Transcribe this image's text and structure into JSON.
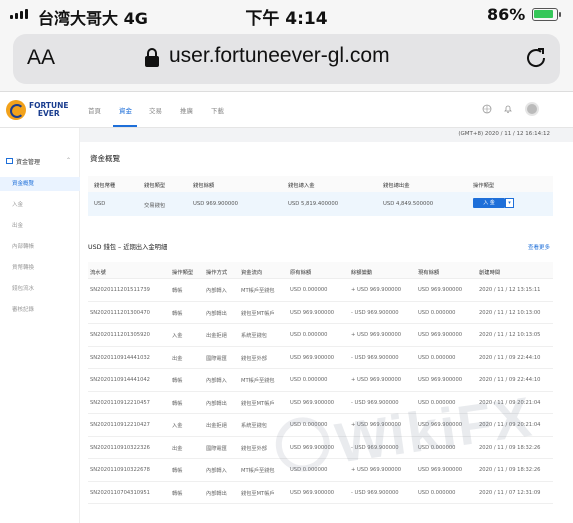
{
  "status_bar": {
    "carrier": "台湾大哥大  4G",
    "time": "下午 4:14",
    "battery": "86%",
    "battery_level": 0.86
  },
  "browser": {
    "aa_label": "AA",
    "url": "user.fortuneever-gl.com"
  },
  "site": {
    "logo_line1": "FORTUNE",
    "logo_line2": "EVER",
    "nav": [
      "首頁",
      "資金",
      "交易",
      "推廣",
      "下載"
    ],
    "active_nav": 1,
    "timezone_bar": "(GMT+8) 2020 / 11 / 12 16:14:12"
  },
  "sidebar": {
    "header": "資金管理",
    "items": [
      "資金概覽",
      "入金",
      "出金",
      "內部轉帳",
      "貨幣轉換",
      "錢包流水",
      "審核記錄"
    ],
    "active_index": 0
  },
  "overview": {
    "title": "資金概覽",
    "headers": [
      "錢包幣種",
      "錢包類型",
      "錢包餘額",
      "錢包總入金",
      "錢包總出金",
      "操作類型"
    ],
    "row": [
      "USD",
      "交易錢包",
      "USD 969.900000",
      "USD 5,819.400000",
      "USD 4,849.500000"
    ],
    "deposit_button": "入 金",
    "more_button": "▾"
  },
  "transactions": {
    "title": "USD 錢包 – 近期出入金明細",
    "view_more": "查看更多",
    "headers": [
      "流水號",
      "操作類型",
      "操作方式",
      "資金流向",
      "原有餘額",
      "餘額變動",
      "現有餘額",
      "創建時間"
    ],
    "rows": [
      [
        "SN2020111201511739",
        "轉帳",
        "內部轉入",
        "MT帳戶至錢包",
        "USD 0.000000",
        "+ USD 969.900000",
        "USD 969.900000",
        "2020 / 11 / 12 13:15:11"
      ],
      [
        "SN2020111201300470",
        "轉帳",
        "內部轉出",
        "錢包至MT帳戶",
        "USD 969.900000",
        "- USD 969.900000",
        "USD 0.000000",
        "2020 / 11 / 12 10:13:00"
      ],
      [
        "SN2020111201305920",
        "入金",
        "出金拒絕",
        "系統至錢包",
        "USD 0.000000",
        "+ USD 969.900000",
        "USD 969.900000",
        "2020 / 11 / 12 10:13:05"
      ],
      [
        "SN2020110914441032",
        "出金",
        "國際電匯",
        "錢包至外部",
        "USD 969.900000",
        "- USD 969.900000",
        "USD 0.000000",
        "2020 / 11 / 09 22:44:10"
      ],
      [
        "SN2020110914441042",
        "轉帳",
        "內部轉入",
        "MT帳戶至錢包",
        "USD 0.000000",
        "+ USD 969.900000",
        "USD 969.900000",
        "2020 / 11 / 09 22:44:10"
      ],
      [
        "SN2020110912210457",
        "轉帳",
        "內部轉出",
        "錢包至MT帳戶",
        "USD 969.900000",
        "- USD 969.900000",
        "USD 0.000000",
        "2020 / 11 / 09 20:21:04"
      ],
      [
        "SN2020110912210427",
        "入金",
        "出金拒絕",
        "系統至錢包",
        "USD 0.000000",
        "+ USD 969.900000",
        "USD 969.900000",
        "2020 / 11 / 09 20:21:04"
      ],
      [
        "SN2020110910322326",
        "出金",
        "國際電匯",
        "錢包至外部",
        "USD 969.900000",
        "- USD 969.900000",
        "USD 0.000000",
        "2020 / 11 / 09 18:32:26"
      ],
      [
        "SN2020110910322678",
        "轉帳",
        "內部轉入",
        "MT帳戶至錢包",
        "USD 0.000000",
        "+ USD 969.900000",
        "USD 969.900000",
        "2020 / 11 / 09 18:32:26"
      ],
      [
        "SN2020110704310951",
        "轉帳",
        "內部轉出",
        "錢包至MT帳戶",
        "USD 969.900000",
        "- USD 969.900000",
        "USD 0.000000",
        "2020 / 11 / 07 12:31:09"
      ]
    ]
  },
  "watermark": "WikiFX"
}
